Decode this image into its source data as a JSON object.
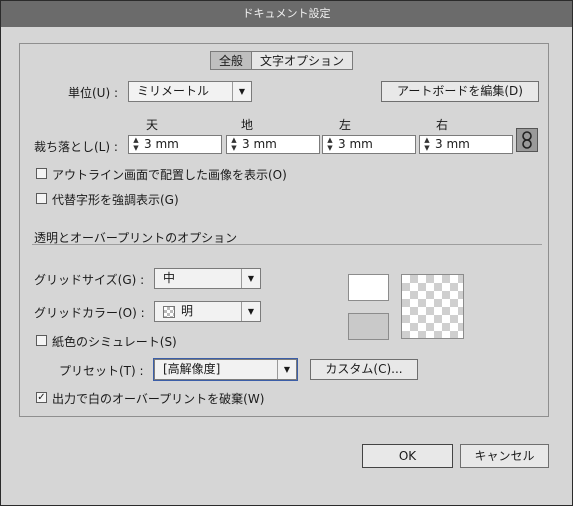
{
  "window": {
    "title": "ドキュメント設定"
  },
  "tabs": [
    {
      "label": "全般"
    },
    {
      "label": "文字オプション"
    }
  ],
  "units": {
    "label": "単位(U) :",
    "value": "ミリメートル"
  },
  "artboard_button": "アートボードを編集(D)",
  "bleed": {
    "label": "裁ち落とし(L) :",
    "columns": [
      "天",
      "地",
      "左",
      "右"
    ],
    "values": [
      "3 mm",
      "3 mm",
      "3 mm",
      "3 mm"
    ]
  },
  "checkboxes": {
    "outline_images": {
      "label": "アウトライン画面で配置した画像を表示(O)",
      "checked": false
    },
    "alt_glyphs": {
      "label": "代替字形を強調表示(G)",
      "checked": false
    },
    "paper_color": {
      "label": "紙色のシミュレート(S)",
      "checked": false
    },
    "discard_white": {
      "label": "出力で白のオーバープリントを破棄(W)",
      "checked": true
    }
  },
  "section_title": "透明とオーバープリントのオプション",
  "grid_size": {
    "label": "グリッドサイズ(G) :",
    "value": "中"
  },
  "grid_color": {
    "label": "グリッドカラー(O) :",
    "value": "明"
  },
  "preset": {
    "label": "プリセット(T) :",
    "value": "[高解像度]"
  },
  "custom_button": "カスタム(C)...",
  "ok_button": "OK",
  "cancel_button": "キャンセル",
  "check_mark": "✓",
  "arrow_down": "▼",
  "spin_up": "▲",
  "spin_down": "▼",
  "colors": {
    "accent": "#3b5ea8",
    "background": "#d6d6d6",
    "titlebar": "#6b6b6b"
  }
}
